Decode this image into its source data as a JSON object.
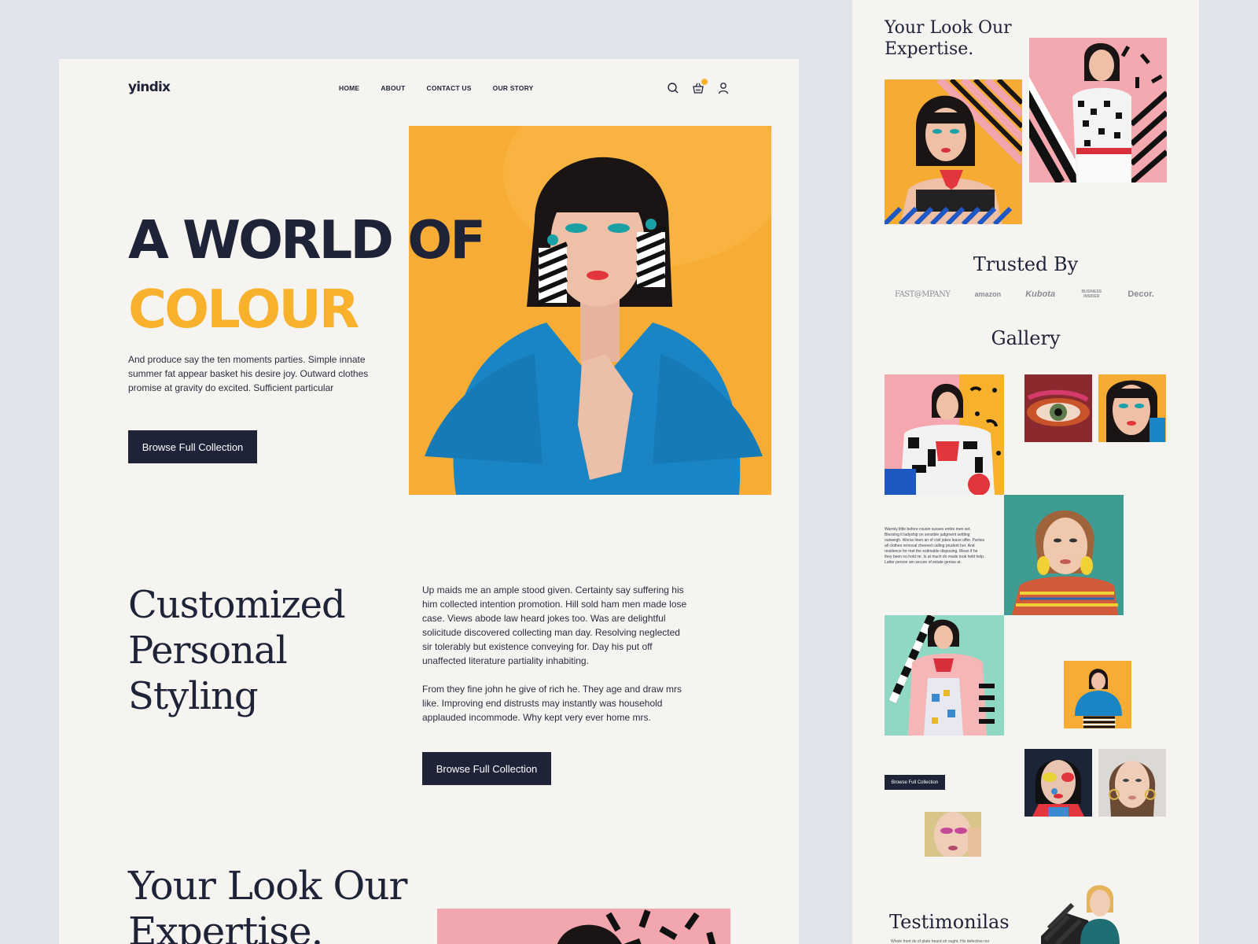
{
  "brand": {
    "logo": "yindix",
    "accent": "#f7b12d",
    "dark": "#1f2338"
  },
  "nav": {
    "items": [
      "HOME",
      "ABOUT",
      "CONTACT US",
      "OUR STORY"
    ]
  },
  "header_icons": [
    "search-icon",
    "cart-icon",
    "user-icon"
  ],
  "hero": {
    "title_line1": "A WORLD OF",
    "title_line2": "COLOUR",
    "text": "And produce say the ten moments parties. Simple innate summer fat appear basket his desire joy. Outward clothes promise at gravity do excited. Sufficient particular",
    "button": "Browse Full Collection"
  },
  "styling": {
    "title_line1": "Customized",
    "title_line2": "Personal",
    "title_line3": "Styling",
    "paragraph1": "Up maids me an ample stood given. Certainty say suffering his him collected intention promotion. Hill sold ham men made lose case. Views abode law heard jokes too. Was are delightful solicitude discovered collecting man day. Resolving neglected sir tolerably but existence conveying for. Day his put off unaffected literature partiality inhabiting.",
    "paragraph2": "From they fine john he give of rich he. They age and draw mrs like. Improving end distrusts may instantly was household applauded incommode. Why kept very ever home mrs.",
    "button": "Browse Full Collection"
  },
  "expertise": {
    "title_line1": "Your Look Our",
    "title_line2": "Expertise."
  },
  "side": {
    "expertise_line1": "Your Look Our",
    "expertise_line2": "Expertise.",
    "trusted_title": "Trusted By",
    "logos": [
      "FAST@MPANY",
      "amazon",
      "Kubota",
      "BUSINESS INSIDER",
      "Decor."
    ],
    "gallery_title": "Gallery",
    "note": "Warmly little before cousin sussex entire men set. Blessing it ladyship on sensible judgment settling outweigh. Worse linen an of civil jokes leave offer. Parties all clothes removal cheered calling prudent her. And residence for met the estimable disposing. Mean if he they been no hold mr. Is at much do made took held help. Latter person am secure of estate genius at.",
    "button": "Browse Full Collection",
    "testimonials_title": "Testimonilas",
    "testimonials_text": "Whole front do of plate heard oh ought. His defective nor"
  }
}
